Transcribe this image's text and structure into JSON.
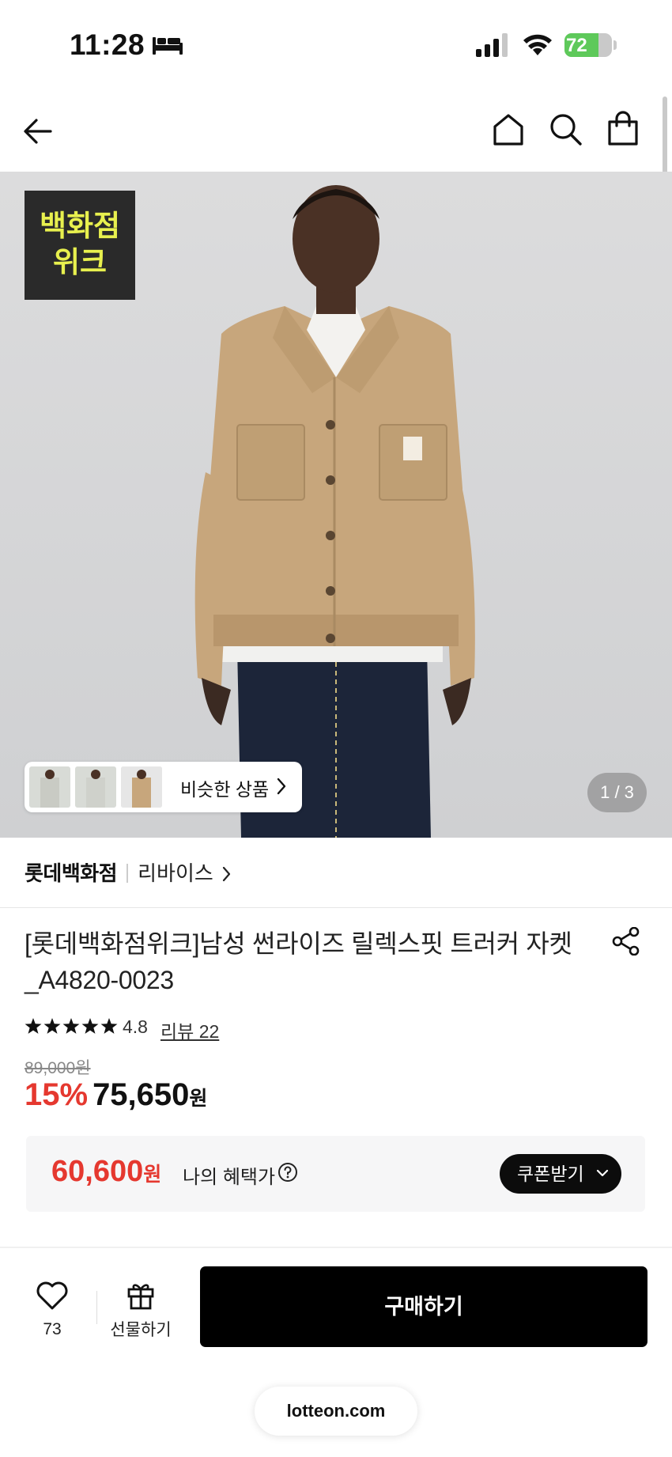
{
  "status_bar": {
    "time": "11:28",
    "battery": "72",
    "battery_level": 0.72,
    "icons": [
      "bed-icon",
      "signal-icon",
      "wifi-icon",
      "battery-icon"
    ]
  },
  "nav": {
    "icons": [
      "back-arrow-icon",
      "home-icon",
      "search-icon",
      "shopping-bag-icon"
    ]
  },
  "hero": {
    "badge": {
      "line1": "백화점",
      "line2": "위크"
    },
    "similar_label": "비슷한 상품",
    "pager": "1 / 3",
    "colors": {
      "jacket": "#c7a67c",
      "jeans": "#1c2539",
      "background": "#d6d7d8"
    }
  },
  "product": {
    "store": "롯데백화점",
    "brand": "리바이스",
    "title": "[롯데백화점위크]남성 썬라이즈 릴렉스핏 트러커 자켓 _A4820-0023",
    "rating_stars": 5,
    "rating": "4.8",
    "reviews_label": "리뷰 22",
    "original_price": "89,000원",
    "discount": "15%",
    "price": "75,650",
    "currency": "원"
  },
  "benefit": {
    "price": "60,600",
    "currency": "원",
    "label": "나의 혜택가",
    "coupon_button": "쿠폰받기"
  },
  "bottom_bar": {
    "like_count": "73",
    "gift_label": "선물하기",
    "buy_label": "구매하기",
    "url": "lotteon.com"
  },
  "colors": {
    "accent_red": "#e5382f",
    "badge_bg": "#2a2a2a",
    "badge_text": "#e8f04e",
    "buy_bg": "#000000"
  }
}
